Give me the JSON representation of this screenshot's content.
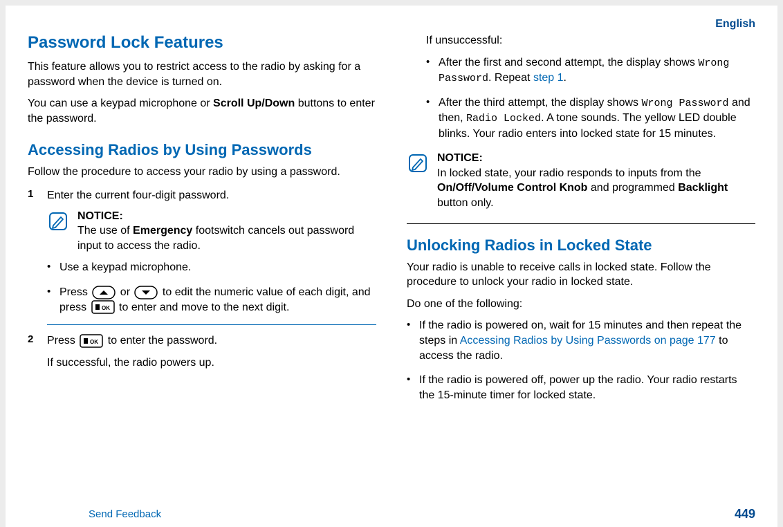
{
  "language": "English",
  "page_number": "449",
  "feedback": "Send Feedback",
  "col1": {
    "h1": "Password Lock Features",
    "p1a": "This feature allows you to restrict access to the radio by asking for a password when the device is turned on.",
    "p1b_pre": "You can use a keypad microphone or ",
    "p1b_bold": "Scroll Up/Down",
    "p1b_post": " buttons to enter the password.",
    "h2": "Accessing Radios by Using Passwords",
    "p2": "Follow the procedure to access your radio by using a password.",
    "step1_num": "1",
    "step1_text": "Enter the current four-digit password.",
    "notice1_title": "NOTICE:",
    "notice1_pre": "The use of ",
    "notice1_bold": "Emergency",
    "notice1_post": " footswitch cancels out password input to access the radio.",
    "bullet1": "Use a keypad microphone.",
    "bullet2_a": "Press ",
    "bullet2_b": " or ",
    "bullet2_c": " to edit the numeric value of each digit, and press ",
    "bullet2_d": " to enter and move to the next digit.",
    "step2_num": "2",
    "step2_a": "Press ",
    "step2_b": " to enter the password.",
    "step2_p": "If successful, the radio powers up."
  },
  "col2": {
    "p0": "If unsuccessful:",
    "bullet1_a": "After the first and second attempt, the display shows ",
    "bullet1_mono": "Wrong Password",
    "bullet1_b": ". Repeat ",
    "bullet1_link": "step 1",
    "bullet1_c": ".",
    "bullet2_a": "After the third attempt, the display shows ",
    "bullet2_mono1": "Wrong Password",
    "bullet2_b": " and then, ",
    "bullet2_mono2": "Radio Locked",
    "bullet2_c": ". A tone sounds. The yellow LED double blinks. Your radio enters into locked state for 15 minutes.",
    "notice_title": "NOTICE:",
    "notice_a": "In locked state, your radio responds to inputs from the ",
    "notice_bold1": "On/Off/Volume Control Knob",
    "notice_b": " and programmed ",
    "notice_bold2": "Backlight",
    "notice_c": " button only.",
    "h2": "Unlocking Radios in Locked State",
    "p2": "Your radio is unable to receive calls in locked state. Follow the procedure to unlock your radio in locked state.",
    "p3": "Do one of the following:",
    "b3a_pre": "If the radio is powered on, wait for 15 minutes and then repeat the steps in ",
    "b3a_link": "Accessing Radios by Using Passwords on page 177",
    "b3a_post": " to access the radio.",
    "b3b": "If the radio is powered off, power up the radio. Your radio restarts the 15-minute timer for locked state."
  }
}
